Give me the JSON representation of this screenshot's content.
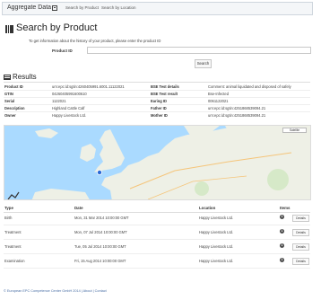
{
  "nav": {
    "brand": "Aggregate Data",
    "links": [
      "Search by Product",
      "Search by Location"
    ]
  },
  "search": {
    "title": "Search by Product",
    "hint": "To get information about the history of your product, please enter the product ID",
    "product_id_label": "Product ID",
    "product_id_value": "",
    "button_label": "Search"
  },
  "results": {
    "title": "Results",
    "left": [
      {
        "label": "Product ID",
        "value": "urn:epc:id:sgtin:4260405991.6001.11122021"
      },
      {
        "label": "GTIN",
        "value": "04260405991600610"
      },
      {
        "label": "Serial",
        "value": "1122021"
      },
      {
        "label": "Description",
        "value": "Highland Cattle Calf"
      },
      {
        "label": "Owner",
        "value": "Happy Livestock Ltd."
      }
    ],
    "right": [
      {
        "label": "BSE Test details",
        "value": "Comment: animal liquidated and disposed of safely"
      },
      {
        "label": "BSE Test result",
        "value": "Bse-Infected"
      },
      {
        "label": "Earing ID",
        "value": "0061122021"
      },
      {
        "label": "Father ID",
        "value": "urn:epc:id:sgtin:4251868539094.21"
      },
      {
        "label": "Mother ID",
        "value": "urn:epc:id:sgtin:4251868539094.21"
      }
    ]
  },
  "map": {
    "satellite_label": "Satellite"
  },
  "events": {
    "columns": [
      "Type",
      "Date",
      "Location",
      "Items"
    ],
    "rows": [
      {
        "type": "Birth",
        "date": "Mon, 31 Mar 2014 10:00:00 GMT",
        "location": "Happy Livestock Ltd.",
        "items": "1",
        "action": "Details"
      },
      {
        "type": "Treatment",
        "date": "Mon, 07 Jul 2014 10:00:00 GMT",
        "location": "Happy Livestock Ltd.",
        "items": "1",
        "action": "Details"
      },
      {
        "type": "Treatment",
        "date": "Tue, 05 Jul 2014 10:00:00 GMT",
        "location": "Happy Livestock Ltd.",
        "items": "1",
        "action": "Details"
      },
      {
        "type": "Examination",
        "date": "Fri, 15 Aug 2014 10:00:00 GMT",
        "location": "Happy Livestock Ltd.",
        "items": "1",
        "action": "Details"
      }
    ]
  },
  "footer": {
    "text": "© European EPC Competence Center GmbH 2014 | About | Contact"
  },
  "colors": {
    "sea": "#aadaff",
    "land": "#eef0e6",
    "marker": "#2a6ad6",
    "footer_link": "#4a6fa5"
  }
}
